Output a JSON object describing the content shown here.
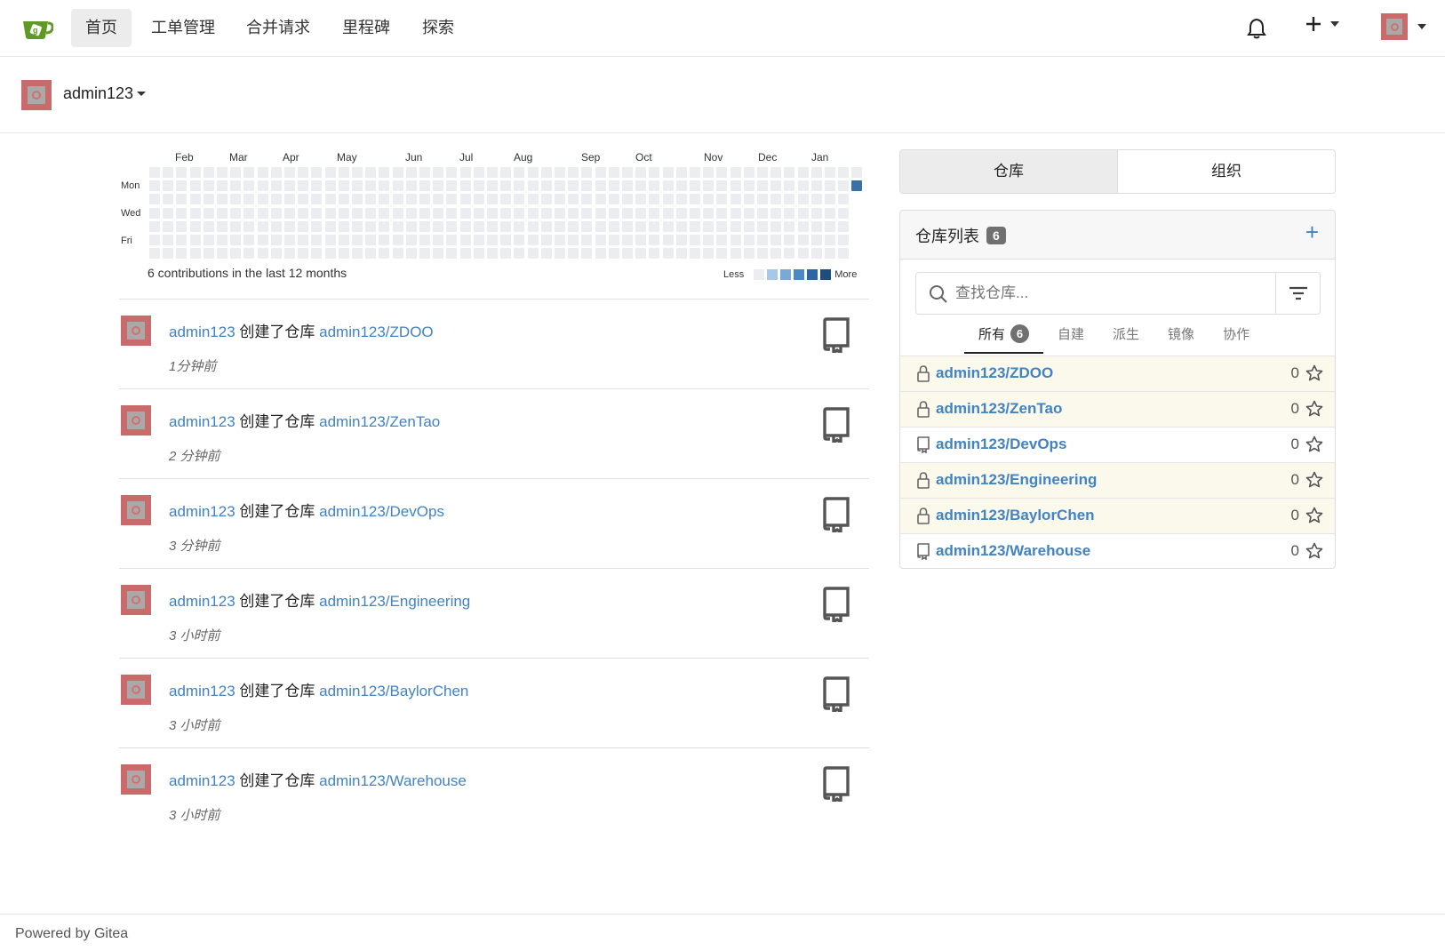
{
  "nav": {
    "items": [
      {
        "label": "首页",
        "active": true
      },
      {
        "label": "工单管理"
      },
      {
        "label": "合并请求"
      },
      {
        "label": "里程碑"
      },
      {
        "label": "探索"
      }
    ],
    "icons": {
      "logo": "gitea-logo",
      "bell": "bell-icon",
      "plus": "plus-icon"
    }
  },
  "user": {
    "name": "admin123"
  },
  "heatmap": {
    "months": [
      "Feb",
      "Mar",
      "Apr",
      "May",
      "Jun",
      "Jul",
      "Aug",
      "Sep",
      "Oct",
      "Nov",
      "Dec",
      "Jan"
    ],
    "days": [
      "Mon",
      "Wed",
      "Fri"
    ],
    "summary": "6 contributions in the last 12 months",
    "less": "Less",
    "more": "More",
    "colors": [
      "#ebedf0",
      "#a8c8e8",
      "#7aa9d8",
      "#4a88c6",
      "#2c66a4",
      "#1e4d80"
    ],
    "active_cell_color": "#3b6fa8"
  },
  "feed": [
    {
      "user": "admin123",
      "action": "创建了仓库",
      "repo": "admin123/ZDOO",
      "time": "1分钟前"
    },
    {
      "user": "admin123",
      "action": "创建了仓库",
      "repo": "admin123/ZenTao",
      "time": "2 分钟前"
    },
    {
      "user": "admin123",
      "action": "创建了仓库",
      "repo": "admin123/DevOps",
      "time": "3 分钟前"
    },
    {
      "user": "admin123",
      "action": "创建了仓库",
      "repo": "admin123/Engineering",
      "time": "3 小时前"
    },
    {
      "user": "admin123",
      "action": "创建了仓库",
      "repo": "admin123/BaylorChen",
      "time": "3 小时前"
    },
    {
      "user": "admin123",
      "action": "创建了仓库",
      "repo": "admin123/Warehouse",
      "time": "3 小时前"
    }
  ],
  "panel": {
    "tabs": [
      {
        "label": "仓库",
        "active": true
      },
      {
        "label": "组织"
      }
    ],
    "title": "仓库列表",
    "count": "6",
    "add": "+",
    "search_placeholder": "查找仓库...",
    "subtabs": [
      {
        "label": "所有",
        "count": "6",
        "active": true
      },
      {
        "label": "自建"
      },
      {
        "label": "派生"
      },
      {
        "label": "镜像"
      },
      {
        "label": "协作"
      }
    ],
    "repos": [
      {
        "name": "admin123/ZDOO",
        "private": true,
        "stars": "0"
      },
      {
        "name": "admin123/ZenTao",
        "private": true,
        "stars": "0"
      },
      {
        "name": "admin123/DevOps",
        "private": false,
        "stars": "0"
      },
      {
        "name": "admin123/Engineering",
        "private": true,
        "stars": "0"
      },
      {
        "name": "admin123/BaylorChen",
        "private": true,
        "stars": "0"
      },
      {
        "name": "admin123/Warehouse",
        "private": false,
        "stars": "0"
      }
    ]
  },
  "footer": {
    "powered": "Powered by Gitea"
  }
}
